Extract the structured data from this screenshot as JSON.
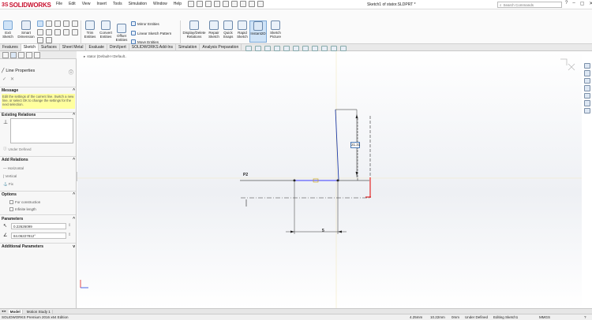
{
  "app": {
    "logo_ds": "3S",
    "logo_name": "SOLIDWORKS",
    "doc_title": "Sketch1 of stator.SLDPRT *",
    "search_placeholder": "Search Commands",
    "menu": [
      "File",
      "Edit",
      "View",
      "Insert",
      "Tools",
      "Simulation",
      "Window",
      "Help"
    ],
    "win_min": "–",
    "win_max": "▢",
    "win_close": "✕",
    "help": "?"
  },
  "ribbon": {
    "exit_sketch": "Exit\nSketch",
    "smart_dimension": "Smart\nDimension",
    "trim_entities": "Trim\nEntities",
    "convert_entities": "Convert\nEntities",
    "offset_entities": "Offset\nEntities",
    "mirror_entities": "Mirror Entities",
    "linear_sketch_pattern": "Linear Sketch Pattern",
    "move_entities": "Move Entities",
    "display_delete_relations": "Display/Delete\nRelations",
    "repair_sketch": "Repair\nSketch",
    "quick_snaps": "Quick\nSnaps",
    "rapid_sketch": "Rapid\nSketch",
    "instant2d": "Instant2D",
    "sketch_picture": "Sketch\nPicture"
  },
  "tabs": [
    "Features",
    "Sketch",
    "Surfaces",
    "Sheet Metal",
    "Evaluate",
    "DimXpert",
    "SOLIDWORKS Add-Ins",
    "Simulation",
    "Analysis Preparation"
  ],
  "active_tab": "Sketch",
  "property_manager": {
    "title": "Line Properties",
    "ok": "✓",
    "cancel": "✕",
    "message_heading": "Message",
    "message_text": "Edit the settings of the current line. Switch a new line, or select OK to change the settings for the next selection.",
    "existing_relations_heading": "Existing Relations",
    "under_defined": "Under Defined",
    "add_relations_heading": "Add Relations",
    "relations": [
      "Horizontal",
      "Vertical",
      "Fix"
    ],
    "options_heading": "Options",
    "options": [
      "For construction",
      "Infinite length"
    ],
    "parameters_heading": "Parameters",
    "length_value": "0.22626099",
    "angle_value": "84.06227812°",
    "additional_heading": "Additional Parameters"
  },
  "viewport": {
    "breadcrumb": "stator (Default<<Default..",
    "dimension_box": "21.31",
    "dimension_bottom": "5",
    "point_label": "P2"
  },
  "bottom_tabs": [
    "Model",
    "Motion Study 1"
  ],
  "active_bottom_tab": "Model",
  "status": {
    "edition": "SOLIDWORKS Premium 2016 x64 Edition",
    "x": "4.25mm",
    "y": "10.22mm",
    "z": "0mm",
    "state": "Under Defined",
    "editing": "Editing Sketch1",
    "units": "MMGS"
  }
}
